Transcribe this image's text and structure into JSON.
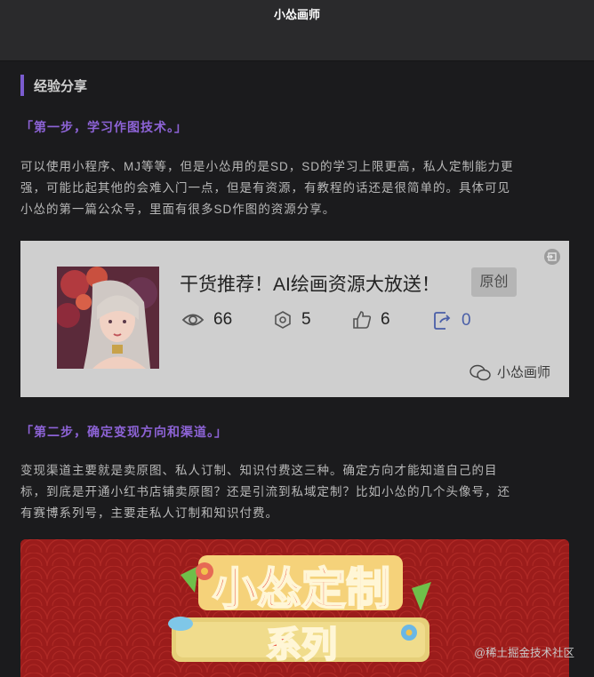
{
  "header": {
    "title": "小怂画师"
  },
  "section": {
    "title": "经验分享"
  },
  "step1": {
    "heading": "「第一步，学习作图技术。」",
    "lines": [
      "可以使用小程序、MJ等等，但是小怂用的是SD，SD的学习上限更高，私人定制能力更",
      "强，可能比起其他的会难入门一点，但是有资源，有教程的话还是很简单的。具体可见",
      "小怂的第一篇公众号，里面有很多SD作图的资源分享。"
    ]
  },
  "card": {
    "title": "干货推荐！AI绘画资源大放送！",
    "badge": "原创",
    "stats": {
      "views": "66",
      "shares": "5",
      "likes": "6",
      "forwards": "0"
    },
    "brand": "小怂画师"
  },
  "step2": {
    "heading": "「第二步，确定变现方向和渠道。」",
    "lines": [
      "变现渠道主要就是卖原图、私人订制、知识付费这三种。确定方向才能知道自己的目",
      "标，到底是开通小红书店铺卖原图？还是引流到私域定制？比如小怂的几个头像号，还",
      "有赛博系列号，主要走私人订制和知识付费。"
    ]
  },
  "banner": {
    "line1": "小怂定制",
    "line2": "系列"
  },
  "watermark": "@稀土掘金技术社区",
  "colors": {
    "accent": "#7b5ccf",
    "step": "#8d63d6",
    "banner": "#9b1c1b"
  }
}
